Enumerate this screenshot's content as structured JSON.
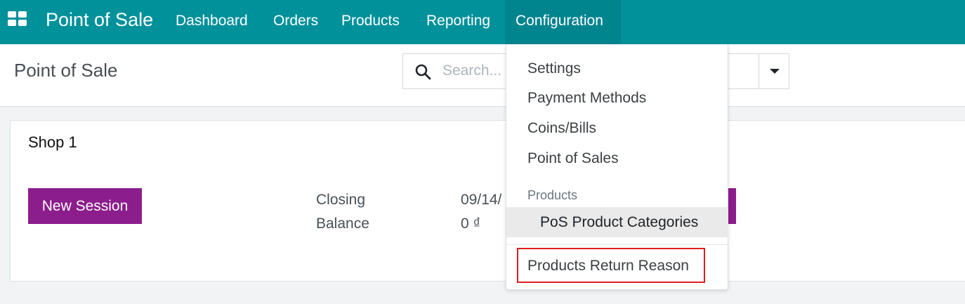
{
  "navbar": {
    "brand": "Point of Sale",
    "items": [
      {
        "label": "Dashboard"
      },
      {
        "label": "Orders"
      },
      {
        "label": "Products"
      },
      {
        "label": "Reporting"
      },
      {
        "label": "Configuration",
        "active": true
      }
    ]
  },
  "control_panel": {
    "title": "Point of Sale",
    "search": {
      "placeholder": "Search...",
      "value": ""
    }
  },
  "card": {
    "shop_name": "Shop 1",
    "new_session_label": "New Session",
    "closing_label": "Closing",
    "closing_value": "09/14/",
    "balance_label": "Balance",
    "balance_value": "0 ₫"
  },
  "config_menu": {
    "items": [
      "Settings",
      "Payment Methods",
      "Coins/Bills",
      "Point of Sales"
    ],
    "section_header": "Products",
    "highlighted_item": "PoS Product Categories",
    "boxed_item": "Products Return Reason"
  },
  "colors": {
    "navbar": "#00919b",
    "navbar_active": "#00848e",
    "primary_button": "#8c1d8c",
    "highlight_box": "#e01d1d"
  },
  "icons": [
    "apps-grid-icon",
    "search-icon",
    "caret-down-icon"
  ]
}
